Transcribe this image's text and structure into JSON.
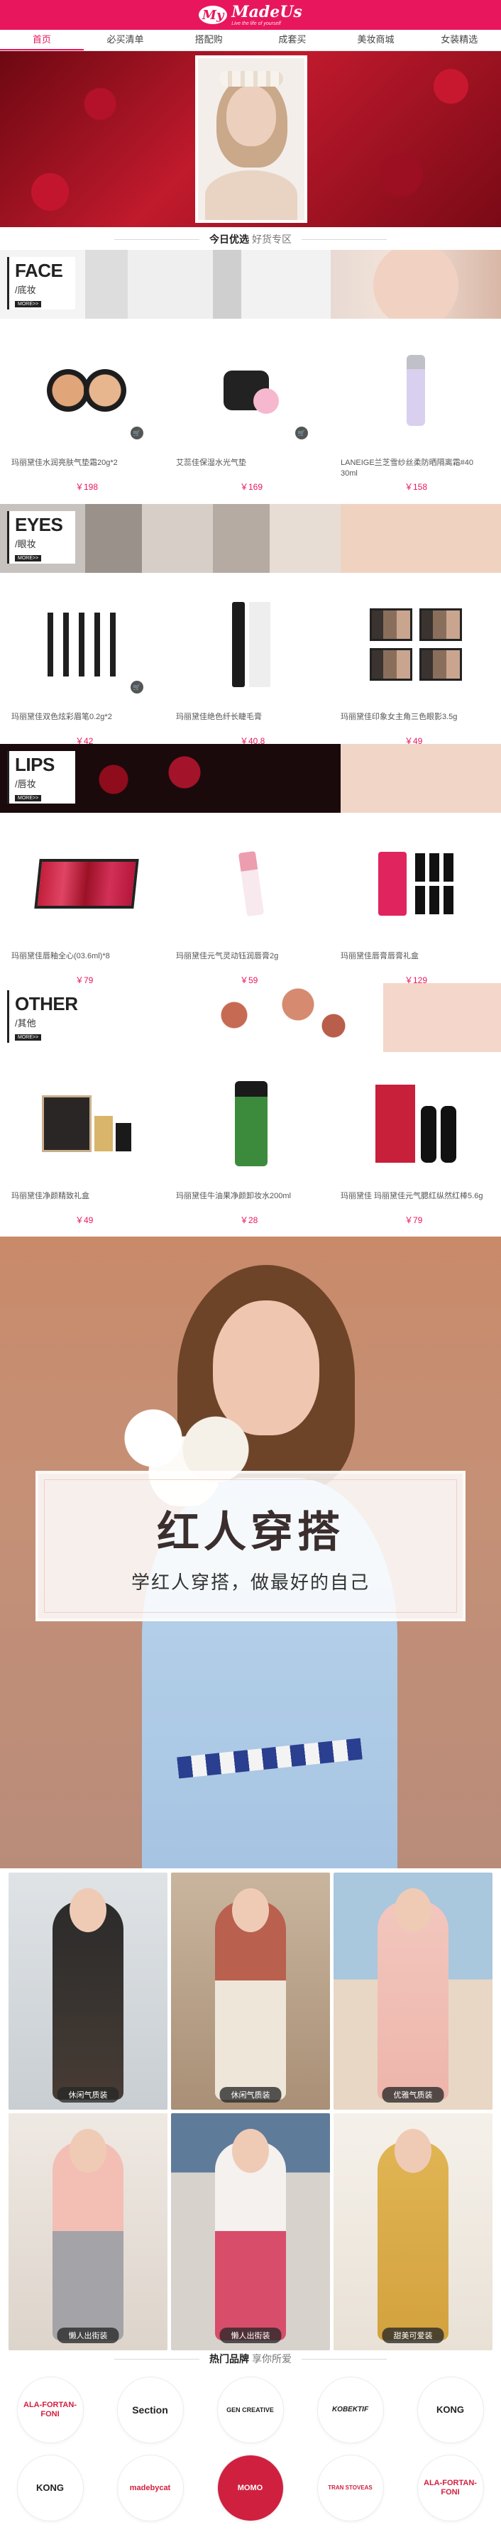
{
  "brand": {
    "logo_mark": "My",
    "logo_name": "MadeUs",
    "tagline": "Live the life of yourself"
  },
  "nav": [
    {
      "label": "首页",
      "active": true
    },
    {
      "label": "必买清单",
      "active": false
    },
    {
      "label": "搭配购",
      "active": false
    },
    {
      "label": "成套买",
      "active": false
    },
    {
      "label": "美妆商城",
      "active": false
    },
    {
      "label": "女装精选",
      "active": false
    }
  ],
  "section_today": {
    "strong": "今日优选",
    "sub": "好货专区"
  },
  "categories": [
    {
      "en": "FACE",
      "cn": "/底妆",
      "more": "MORE>>",
      "products": [
        {
          "name": "玛丽黛佳水润亮肤气垫霜20g*2",
          "price": "￥198"
        },
        {
          "name": "艾蕊佳保湿水光气垫",
          "price": "￥169"
        },
        {
          "name": "LANEIGE兰芝雪纱丝柔防晒隔离霜#40 30ml",
          "price": "￥158"
        }
      ]
    },
    {
      "en": "EYES",
      "cn": "/眼妆",
      "more": "MORE>>",
      "products": [
        {
          "name": "玛丽黛佳双色炫彩眉笔0.2g*2",
          "price": "￥42"
        },
        {
          "name": "玛丽黛佳绝色纤长睫毛膏",
          "price": "￥40.8"
        },
        {
          "name": "玛丽黛佳印象女主角三色眼影3.5g",
          "price": "￥49"
        }
      ]
    },
    {
      "en": "LIPS",
      "cn": "/唇妆",
      "more": "MORE>>",
      "products": [
        {
          "name": "玛丽黛佳唇釉全心(03.6ml)*8",
          "price": "￥79"
        },
        {
          "name": "玛丽黛佳元气灵动钰润唇膏2g",
          "price": "￥59"
        },
        {
          "name": "玛丽黛佳唇膏唇膏礼盒",
          "price": "￥129"
        }
      ]
    },
    {
      "en": "OTHER",
      "cn": "/其他",
      "more": "MORE>>",
      "products": [
        {
          "name": "玛丽黛佳净颜精致礼盒",
          "price": "￥49"
        },
        {
          "name": "玛丽黛佳牛油果净颜卸妆水200ml",
          "price": "￥28"
        },
        {
          "name": "玛丽黛佳 玛丽黛佳元气腮红纵然红棒5.6g",
          "price": "￥79"
        }
      ]
    }
  ],
  "fashion": {
    "title": "红人穿搭",
    "subtitle": "学红人穿搭，做最好的自己"
  },
  "outfits": [
    {
      "label": "休闲气质装"
    },
    {
      "label": "休闲气质装"
    },
    {
      "label": "优雅气质装"
    },
    {
      "label": "懒人出街装"
    },
    {
      "label": "懒人出街装"
    },
    {
      "label": "甜美可爱装"
    }
  ],
  "section_brands": {
    "strong": "热门品牌",
    "sub": "享你所爱"
  },
  "brands": [
    "ALA-FORTAN-FONI",
    "Section",
    "GEN CREATIVE",
    "KOBEKTIF",
    "KONG",
    "KONG",
    "madebycat",
    "MOMO",
    "TRAN STOVEAS",
    "ALA-FORTAN-FONI"
  ],
  "colors": {
    "accent": "#e8175d",
    "header": "#e8175d",
    "price": "#e8175d"
  }
}
